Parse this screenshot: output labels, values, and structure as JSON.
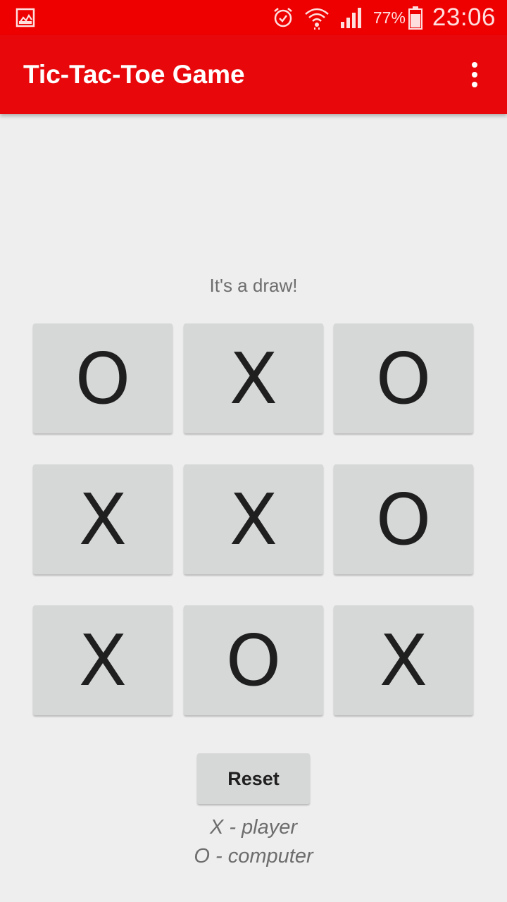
{
  "status_bar": {
    "battery_percent": "77%",
    "time": "23:06",
    "icons": [
      "gallery-notification-icon",
      "alarm-icon",
      "wifi-icon",
      "signal-icon",
      "battery-icon"
    ]
  },
  "app_bar": {
    "title": "Tic-Tac-Toe Game",
    "menu_icon": "overflow-menu-icon"
  },
  "game": {
    "status": "It's a draw!",
    "board": [
      [
        "O",
        "X",
        "O"
      ],
      [
        "X",
        "X",
        "O"
      ],
      [
        "X",
        "O",
        "X"
      ]
    ]
  },
  "controls": {
    "reset_label": "Reset"
  },
  "legend": {
    "player": "X - player",
    "computer": "O - computer"
  },
  "colors": {
    "status_bar": "#ee0000",
    "app_bar": "#e8080b",
    "background": "#eeeeee",
    "cell": "#d6d7d7"
  }
}
